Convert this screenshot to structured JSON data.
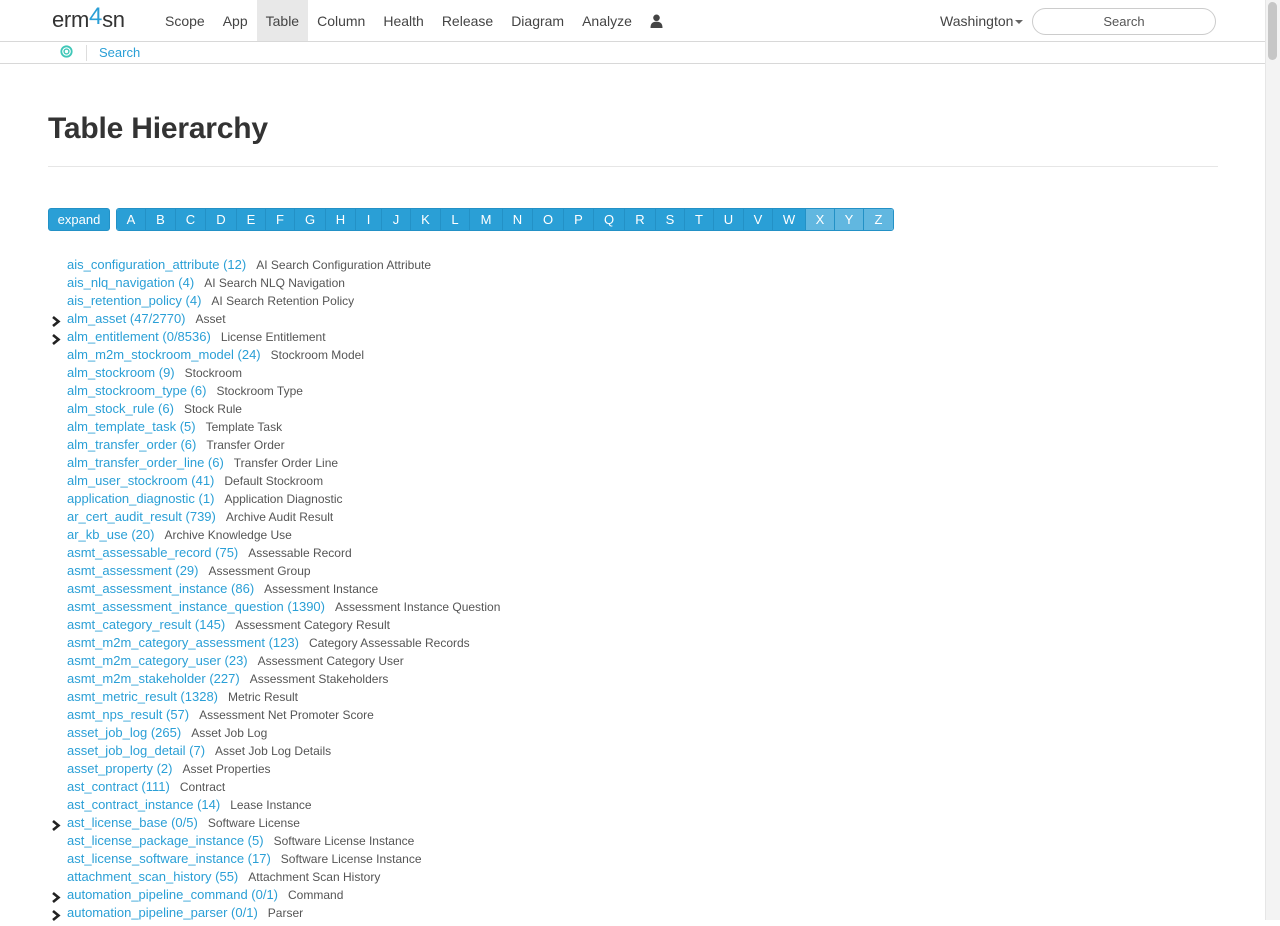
{
  "navbar": {
    "brand_prefix": "erm",
    "brand_number": "4",
    "brand_suffix": "sn",
    "items": [
      {
        "label": "Scope"
      },
      {
        "label": "App"
      },
      {
        "label": "Table",
        "active": true
      },
      {
        "label": "Column"
      },
      {
        "label": "Health"
      },
      {
        "label": "Release"
      },
      {
        "label": "Diagram"
      },
      {
        "label": "Analyze"
      }
    ],
    "user_icon": "user-icon",
    "region": "Washington",
    "search_placeholder": "Search"
  },
  "subbar": {
    "icon": "servicenow-logo-icon",
    "link": "Search"
  },
  "page": {
    "title": "Table Hierarchy",
    "expand_label": "expand",
    "letters": [
      "A",
      "B",
      "C",
      "D",
      "E",
      "F",
      "G",
      "H",
      "I",
      "J",
      "K",
      "L",
      "M",
      "N",
      "O",
      "P",
      "Q",
      "R",
      "S",
      "T",
      "U",
      "V",
      "W",
      "X",
      "Y",
      "Z"
    ],
    "dim_letters": [
      "X",
      "Y",
      "Z"
    ]
  },
  "colors": {
    "accent": "#2a9fd6",
    "accent_dim": "#61b7e0",
    "text": "#333333",
    "label": "#555555"
  },
  "tables": [
    {
      "name": "ais_configuration_attribute (12)",
      "label": "AI Search Configuration Attribute",
      "expandable": false
    },
    {
      "name": "ais_nlq_navigation (4)",
      "label": "AI Search NLQ Navigation",
      "expandable": false
    },
    {
      "name": "ais_retention_policy (4)",
      "label": "AI Search Retention Policy",
      "expandable": false
    },
    {
      "name": "alm_asset (47/2770)",
      "label": "Asset",
      "expandable": true
    },
    {
      "name": "alm_entitlement (0/8536)",
      "label": "License Entitlement",
      "expandable": true
    },
    {
      "name": "alm_m2m_stockroom_model (24)",
      "label": "Stockroom Model",
      "expandable": false
    },
    {
      "name": "alm_stockroom (9)",
      "label": "Stockroom",
      "expandable": false
    },
    {
      "name": "alm_stockroom_type (6)",
      "label": "Stockroom Type",
      "expandable": false
    },
    {
      "name": "alm_stock_rule (6)",
      "label": "Stock Rule",
      "expandable": false
    },
    {
      "name": "alm_template_task (5)",
      "label": "Template Task",
      "expandable": false
    },
    {
      "name": "alm_transfer_order (6)",
      "label": "Transfer Order",
      "expandable": false
    },
    {
      "name": "alm_transfer_order_line (6)",
      "label": "Transfer Order Line",
      "expandable": false
    },
    {
      "name": "alm_user_stockroom (41)",
      "label": "Default Stockroom",
      "expandable": false
    },
    {
      "name": "application_diagnostic (1)",
      "label": "Application Diagnostic",
      "expandable": false
    },
    {
      "name": "ar_cert_audit_result (739)",
      "label": "Archive Audit Result",
      "expandable": false
    },
    {
      "name": "ar_kb_use (20)",
      "label": "Archive Knowledge Use",
      "expandable": false
    },
    {
      "name": "asmt_assessable_record (75)",
      "label": "Assessable Record",
      "expandable": false
    },
    {
      "name": "asmt_assessment (29)",
      "label": "Assessment Group",
      "expandable": false
    },
    {
      "name": "asmt_assessment_instance (86)",
      "label": "Assessment Instance",
      "expandable": false
    },
    {
      "name": "asmt_assessment_instance_question (1390)",
      "label": "Assessment Instance Question",
      "expandable": false
    },
    {
      "name": "asmt_category_result (145)",
      "label": "Assessment Category Result",
      "expandable": false
    },
    {
      "name": "asmt_m2m_category_assessment (123)",
      "label": "Category Assessable Records",
      "expandable": false
    },
    {
      "name": "asmt_m2m_category_user (23)",
      "label": "Assessment Category User",
      "expandable": false
    },
    {
      "name": "asmt_m2m_stakeholder (227)",
      "label": "Assessment Stakeholders",
      "expandable": false
    },
    {
      "name": "asmt_metric_result (1328)",
      "label": "Metric Result",
      "expandable": false
    },
    {
      "name": "asmt_nps_result (57)",
      "label": "Assessment Net Promoter Score",
      "expandable": false
    },
    {
      "name": "asset_job_log (265)",
      "label": "Asset Job Log",
      "expandable": false
    },
    {
      "name": "asset_job_log_detail (7)",
      "label": "Asset Job Log Details",
      "expandable": false
    },
    {
      "name": "asset_property (2)",
      "label": "Asset Properties",
      "expandable": false
    },
    {
      "name": "ast_contract (111)",
      "label": "Contract",
      "expandable": false
    },
    {
      "name": "ast_contract_instance (14)",
      "label": "Lease Instance",
      "expandable": false
    },
    {
      "name": "ast_license_base (0/5)",
      "label": "Software License",
      "expandable": true
    },
    {
      "name": "ast_license_package_instance (5)",
      "label": "Software License Instance",
      "expandable": false
    },
    {
      "name": "ast_license_software_instance (17)",
      "label": "Software License Instance",
      "expandable": false
    },
    {
      "name": "attachment_scan_history (55)",
      "label": "Attachment Scan History",
      "expandable": false
    },
    {
      "name": "automation_pipeline_command (0/1)",
      "label": "Command",
      "expandable": true
    },
    {
      "name": "automation_pipeline_parser (0/1)",
      "label": "Parser",
      "expandable": true
    }
  ]
}
